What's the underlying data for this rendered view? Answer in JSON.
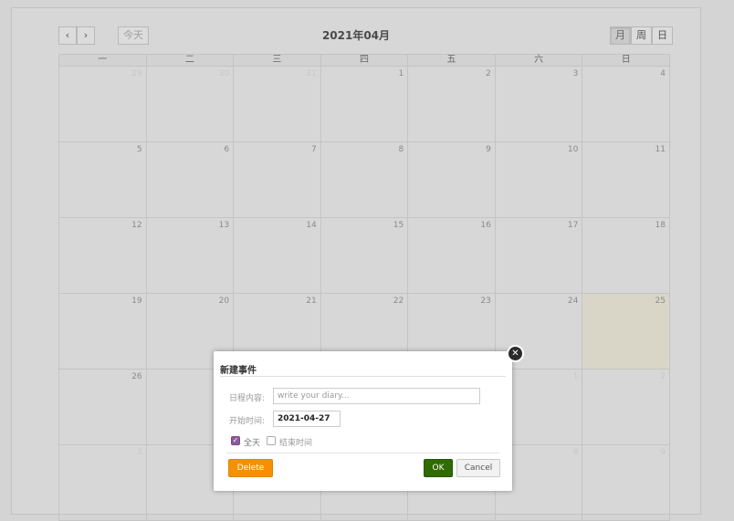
{
  "toolbar": {
    "prev_icon": "‹",
    "next_icon": "›",
    "today_label": "今天",
    "title": "2021年04月",
    "view_month": "月",
    "view_week": "周",
    "view_day": "日"
  },
  "calendar": {
    "weekdays": [
      "一",
      "二",
      "三",
      "四",
      "五",
      "六",
      "日"
    ],
    "weeks": [
      [
        "29",
        "30",
        "31",
        "1",
        "2",
        "3",
        "4"
      ],
      [
        "5",
        "6",
        "7",
        "8",
        "9",
        "10",
        "11"
      ],
      [
        "12",
        "13",
        "14",
        "15",
        "16",
        "17",
        "18"
      ],
      [
        "19",
        "20",
        "21",
        "22",
        "23",
        "24",
        "25"
      ],
      [
        "26",
        "",
        "",
        "",
        "",
        "1",
        "2"
      ],
      [
        "3",
        "",
        "",
        "",
        "",
        "8",
        "9"
      ]
    ]
  },
  "dialog": {
    "close_icon": "✕",
    "title": "新建事件",
    "content_label": "日程内容:",
    "content_placeholder": "write your diary...",
    "start_label": "开始时间:",
    "start_value": "2021-04-27",
    "allday_label": "全天",
    "endtime_label": "结束时间",
    "delete_label": "Delete",
    "ok_label": "OK",
    "cancel_label": "Cancel"
  },
  "colors": {
    "today_highlight": "#d9d6c8",
    "delete_button": "#f39200",
    "ok_button": "#2f6b00",
    "checkbox": "#8e5b9a"
  }
}
